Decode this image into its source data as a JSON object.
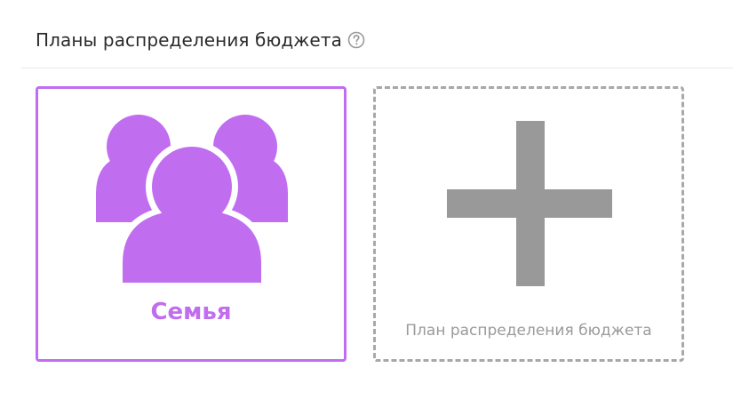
{
  "header": {
    "title": "Планы распределения бюджета",
    "help_icon": "question-circle-icon"
  },
  "plans": [
    {
      "label": "Семья",
      "icon": "family-group-icon",
      "selected": true,
      "accent_color": "#c06df0"
    }
  ],
  "add_plan": {
    "label": "План распределения бюджета",
    "icon": "plus-icon",
    "color": "#999999"
  }
}
